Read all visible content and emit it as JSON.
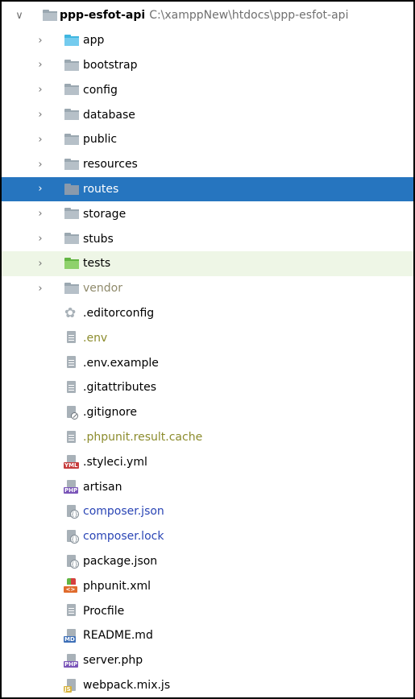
{
  "project": {
    "name": "ppp-esfot-api",
    "path": "C:\\xamppNew\\htdocs\\ppp-esfot-api",
    "expanded_chevron": "∨"
  },
  "folders": [
    {
      "label": "app",
      "icon": "folder-blue-icon",
      "state": "normal"
    },
    {
      "label": "bootstrap",
      "icon": "folder-icon",
      "state": "normal"
    },
    {
      "label": "config",
      "icon": "folder-icon",
      "state": "normal"
    },
    {
      "label": "database",
      "icon": "folder-icon",
      "state": "normal"
    },
    {
      "label": "public",
      "icon": "folder-icon",
      "state": "normal"
    },
    {
      "label": "resources",
      "icon": "folder-icon",
      "state": "normal"
    },
    {
      "label": "routes",
      "icon": "folder-icon",
      "state": "selected"
    },
    {
      "label": "storage",
      "icon": "folder-icon",
      "state": "normal"
    },
    {
      "label": "stubs",
      "icon": "folder-icon",
      "state": "normal"
    },
    {
      "label": "tests",
      "icon": "folder-green-icon",
      "state": "highlight"
    },
    {
      "label": "vendor",
      "icon": "folder-icon",
      "state": "excluded"
    }
  ],
  "files": [
    {
      "label": ".editorconfig",
      "icon": "gear-icon",
      "status": "normal"
    },
    {
      "label": ".env",
      "icon": "text-file-icon",
      "status": "ignored"
    },
    {
      "label": ".env.example",
      "icon": "text-file-icon",
      "status": "normal"
    },
    {
      "label": ".gitattributes",
      "icon": "text-file-icon",
      "status": "normal"
    },
    {
      "label": ".gitignore",
      "icon": "gitignore-file-icon",
      "status": "normal"
    },
    {
      "label": ".phpunit.result.cache",
      "icon": "text-file-icon",
      "status": "ignored"
    },
    {
      "label": ".styleci.yml",
      "icon": "yml-file-icon",
      "status": "normal"
    },
    {
      "label": "artisan",
      "icon": "php-file-icon",
      "status": "normal"
    },
    {
      "label": "composer.json",
      "icon": "json-file-icon",
      "status": "modified"
    },
    {
      "label": "composer.lock",
      "icon": "json-file-icon",
      "status": "modified"
    },
    {
      "label": "package.json",
      "icon": "json-file-icon",
      "status": "normal"
    },
    {
      "label": "phpunit.xml",
      "icon": "phpunit-xml-icon",
      "status": "normal"
    },
    {
      "label": "Procfile",
      "icon": "text-file-icon",
      "status": "normal"
    },
    {
      "label": "README.md",
      "icon": "md-file-icon",
      "status": "normal"
    },
    {
      "label": "server.php",
      "icon": "php-file-icon",
      "status": "normal"
    },
    {
      "label": "webpack.mix.js",
      "icon": "js-file-icon",
      "status": "normal"
    }
  ],
  "icon_tags": {
    "yml": "YML",
    "php": "PHP",
    "md": "MD",
    "js": "JS",
    "xml": "<>",
    "json": "{}"
  },
  "colors": {
    "selection": "#2675bf",
    "highlight": "#eef6e6",
    "modified": "#2a45b5",
    "ignored": "#8c8c2d",
    "excluded": "#8f8a6b"
  },
  "collapsed_chevron": "›"
}
